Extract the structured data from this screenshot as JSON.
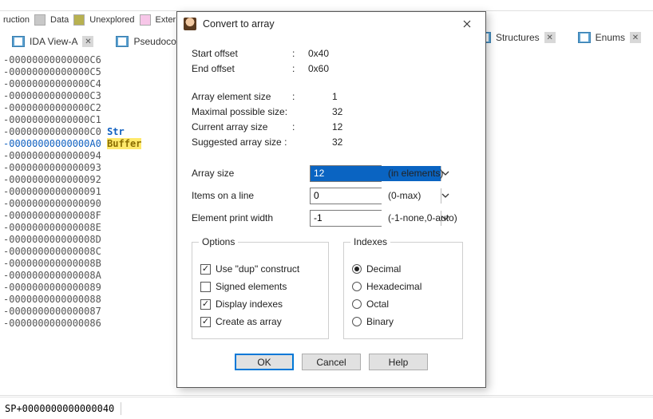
{
  "legend": {
    "instruction": "ruction",
    "data": "Data",
    "unexplored": "Unexplored",
    "external": "Externa"
  },
  "tabs": {
    "ida_view": "IDA View-A",
    "pseudocode": "Pseudoco",
    "structures": "Structures",
    "enums": "Enums"
  },
  "disasm": {
    "lines": [
      "-00000000000000C6",
      "-00000000000000C5",
      "-00000000000000C4",
      "-00000000000000C3",
      "-00000000000000C2",
      "-00000000000000C1",
      "-00000000000000C0",
      "-00000000000000A0",
      "-0000000000000094",
      "-0000000000000093",
      "-0000000000000092",
      "-0000000000000091",
      "-0000000000000090",
      "-000000000000008F",
      "-000000000000008E",
      "-000000000000008D",
      "-000000000000008C",
      "-000000000000008B",
      "-000000000000008A",
      "-0000000000000089",
      "-0000000000000088",
      "-0000000000000087",
      "-0000000000000086"
    ],
    "sym_str": "Str",
    "sym_buffer": "Buffer"
  },
  "dialog": {
    "title": "Convert to array",
    "start_offset_label": "Start offset",
    "start_offset_val": "0x40",
    "end_offset_label": "End offset",
    "end_offset_val": "0x60",
    "elem_size_label": "Array element size",
    "elem_size_val": "1",
    "max_size_label": "Maximal possible size:",
    "max_size_val": "32",
    "cur_size_label": "Current array size",
    "cur_size_val": "12",
    "sug_size_label": "Suggested array size :",
    "sug_size_val": "32",
    "array_size_label": "Array size",
    "array_size_val": "12",
    "array_size_hint": "(in elements)",
    "items_line_label": "Items on a line",
    "items_line_val": "0",
    "items_line_hint": "(0-max)",
    "print_width_label": "Element print width",
    "print_width_val": "-1",
    "print_width_hint": "(-1-none,0-auto)",
    "options_title": "Options",
    "opt_dup": "Use \"dup\" construct",
    "opt_signed": "Signed elements",
    "opt_display_idx": "Display indexes",
    "opt_create_array": "Create as array",
    "indexes_title": "Indexes",
    "idx_decimal": "Decimal",
    "idx_hex": "Hexadecimal",
    "idx_octal": "Octal",
    "idx_binary": "Binary",
    "ok": "OK",
    "cancel": "Cancel",
    "help": "Help"
  },
  "statusbar": {
    "pos": "SP+0000000000000040"
  }
}
